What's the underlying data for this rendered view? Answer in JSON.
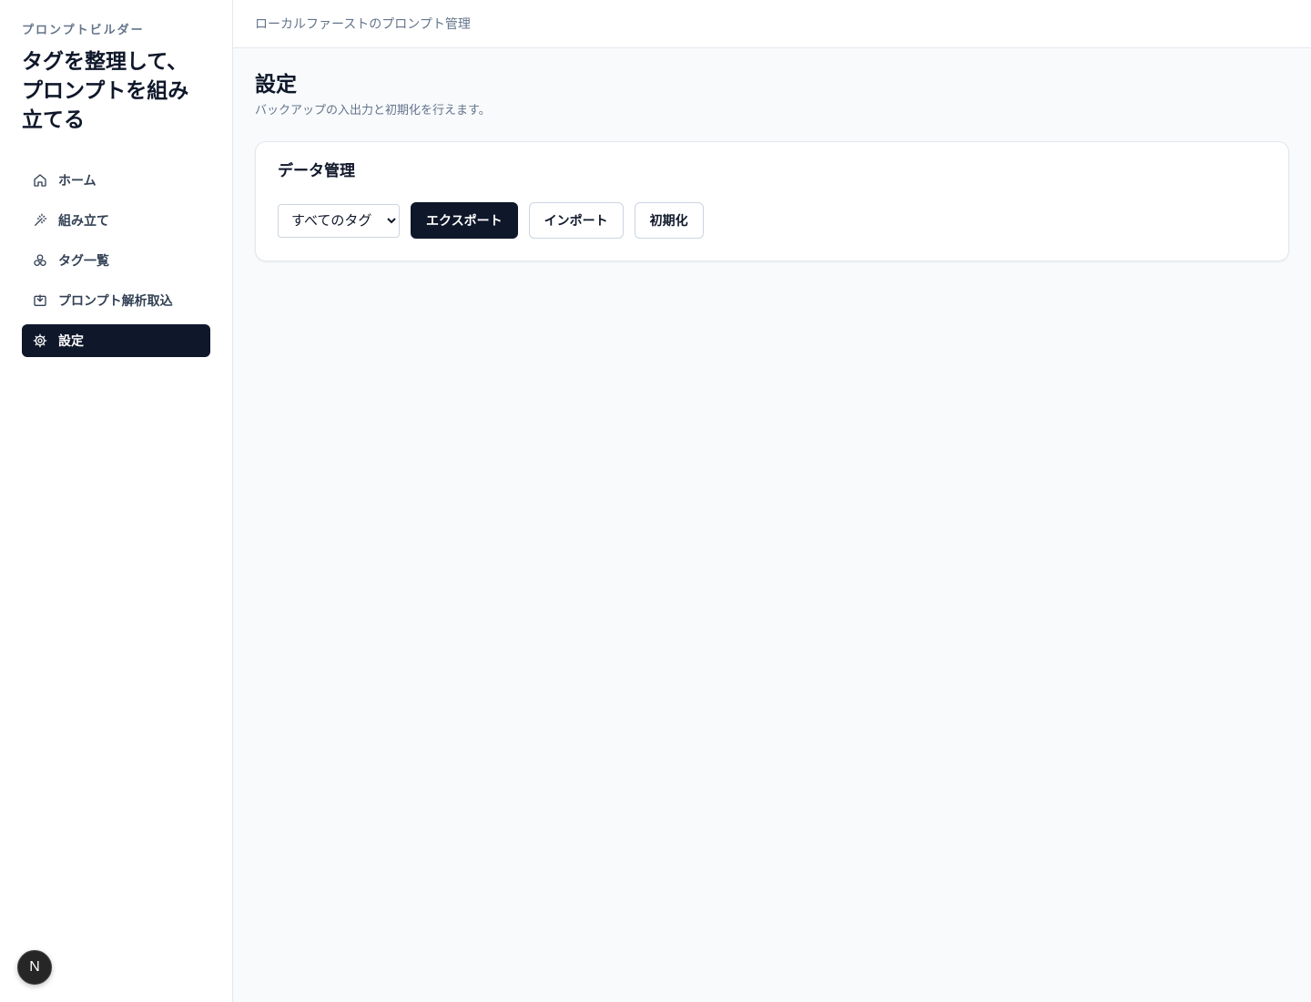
{
  "sidebar": {
    "eyebrow": "プロンプトビルダー",
    "title": "タグを整理して、プロンプトを組み立てる",
    "items": [
      {
        "label": "ホーム",
        "icon": "home-icon",
        "active": false
      },
      {
        "label": "組み立て",
        "icon": "wand-icon",
        "active": false
      },
      {
        "label": "タグ一覧",
        "icon": "tags-icon",
        "active": false
      },
      {
        "label": "プロンプト解析取込",
        "icon": "import-icon",
        "active": false
      },
      {
        "label": "設定",
        "icon": "gear-icon",
        "active": true
      }
    ],
    "badge": "N"
  },
  "topbar": {
    "text": "ローカルファーストのプロンプト管理"
  },
  "page": {
    "title": "設定",
    "subtitle": "バックアップの入出力と初期化を行えます。"
  },
  "data_card": {
    "title": "データ管理",
    "select_value": "すべてのタグ",
    "export_label": "エクスポート",
    "import_label": "インポート",
    "reset_label": "初期化"
  },
  "colors": {
    "accent": "#0f172a",
    "muted_text": "#64748b",
    "border": "#e2e8f0",
    "background": "#f8fafc"
  }
}
